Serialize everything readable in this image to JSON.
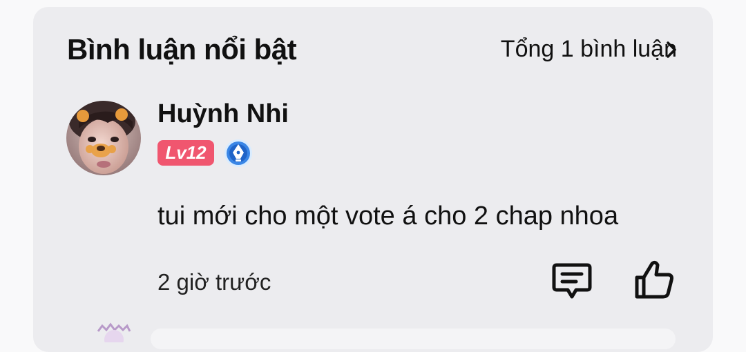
{
  "comments_section": {
    "title": "Bình luận nổi bật",
    "total_label": "Tổng 1 bình luận",
    "chevron_icon": "chevron-right-icon",
    "comment": {
      "username": "Huỳnh Nhi",
      "level": "Lv12",
      "level_color": "#f0566f",
      "rank_icon": "pen-nib-badge-icon",
      "text": "tui mới cho một vote á cho 2 chap nhoa",
      "time": "2 giờ trước",
      "reply_icon": "comment-icon",
      "like_icon": "thumbs-up-icon"
    }
  },
  "colors": {
    "page_bg": "#f9f9fa",
    "card_bg": "#ececef",
    "text": "#111111",
    "badge_blue": "#3a86e6"
  }
}
